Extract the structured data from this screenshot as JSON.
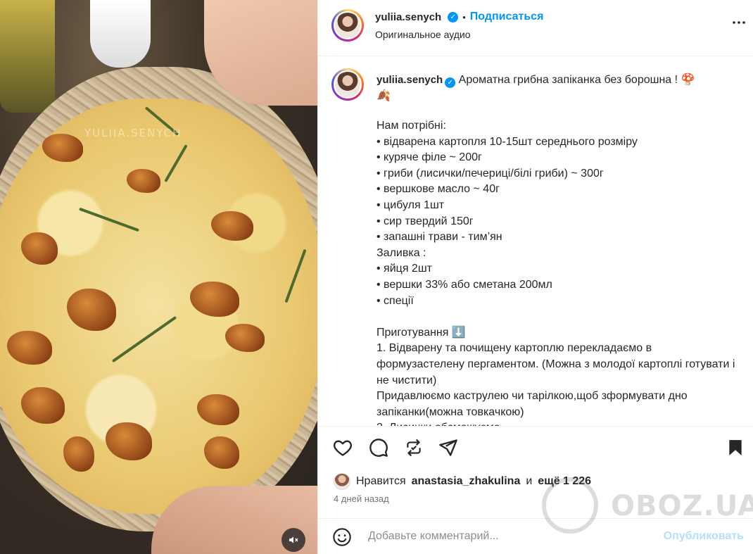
{
  "media": {
    "watermark": "YULIIA.SENYCH",
    "mute_icon": "speaker-muted-icon"
  },
  "header": {
    "username": "yuliia.senych",
    "separator": "•",
    "follow_label": "Подписаться",
    "audio": "Оригинальное аудио",
    "more_icon": "more-horizontal-icon"
  },
  "caption": {
    "username": "yuliia.senych",
    "title": "Ароматна грибна запіканка без борошна ! 🍄",
    "leaf_emoji": "🍂",
    "body": "Нам потрібні:\n• відварена картопля 10-15шт середнього розміру\n• куряче філе ~ 200г\n• гриби (лисички/печериці/білі гриби) ~ 300г\n• вершкове масло ~ 40г\n• цибуля 1шт\n• сир твердий 150г\n• запашні трави - тим’ян\nЗаливка :\n• яйця 2шт\n• вершки 33% або сметана 200мл\n• спеції\n\nПриготування ⬇️\n1. Відварену та почищену картоплю перекладаємо в формузастелену пергаментом. (Можна з молодої картоплі готувати і не чистити)\nПридавлюємо каструлею чи тарілкою,щоб зформувати дно запіканки(можна товкачкою)\n2. Лисички обсмажуємо"
  },
  "actions": {
    "like_icon": "heart-icon",
    "comment_icon": "comment-icon",
    "repost_icon": "repost-icon",
    "share_icon": "share-icon",
    "save_icon": "bookmark-icon"
  },
  "likes": {
    "prefix": "Нравится",
    "user": "anastasia_zhakulina",
    "middle": "и",
    "more": "ещё 1 226"
  },
  "date": "4 дней назад",
  "comment": {
    "placeholder": "Добавьте комментарий...",
    "publish": "Опубликовать",
    "emoji_icon": "smiley-icon"
  },
  "site_watermark": "OBOZ.UA",
  "colors": {
    "accent": "#0095f6",
    "publish_disabled": "#b2dffc",
    "text": "#262626",
    "muted": "#737373"
  }
}
